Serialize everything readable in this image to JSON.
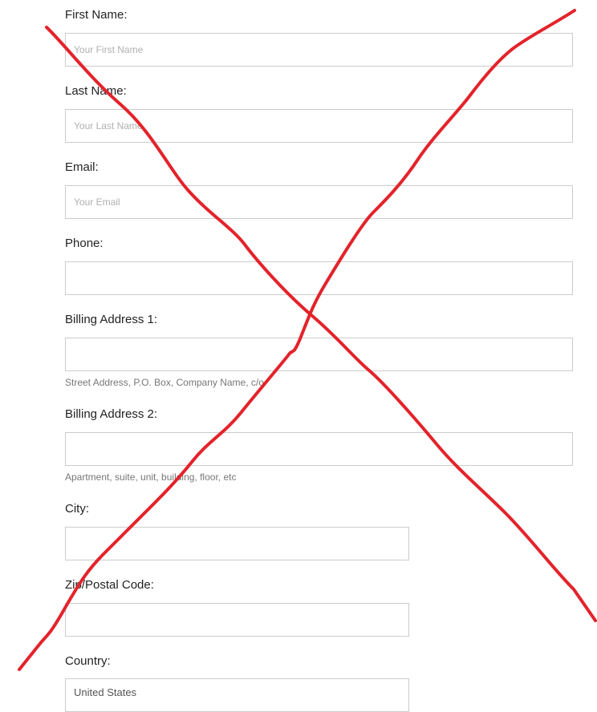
{
  "form": {
    "first_name": {
      "label": "First Name:",
      "placeholder": "Your First Name",
      "value": ""
    },
    "last_name": {
      "label": "Last Name:",
      "placeholder": "Your Last Name",
      "value": ""
    },
    "email": {
      "label": "Email:",
      "placeholder": "Your Email",
      "value": ""
    },
    "phone": {
      "label": "Phone:",
      "placeholder": "",
      "value": ""
    },
    "billing_address_1": {
      "label": "Billing Address 1:",
      "value": "",
      "help": "Street Address, P.O. Box, Company Name, c/o"
    },
    "billing_address_2": {
      "label": "Billing Address 2:",
      "value": "",
      "help": "Apartment, suite, unit, building, floor, etc"
    },
    "city": {
      "label": "City:",
      "value": ""
    },
    "zip": {
      "label": "Zip/Postal Code:",
      "value": ""
    },
    "country": {
      "label": "Country:",
      "selected": "United States"
    }
  },
  "colors": {
    "cross_stroke": "#e3232b",
    "field_border": "#cccccc",
    "label_text": "#222222",
    "help_text": "#777777"
  }
}
